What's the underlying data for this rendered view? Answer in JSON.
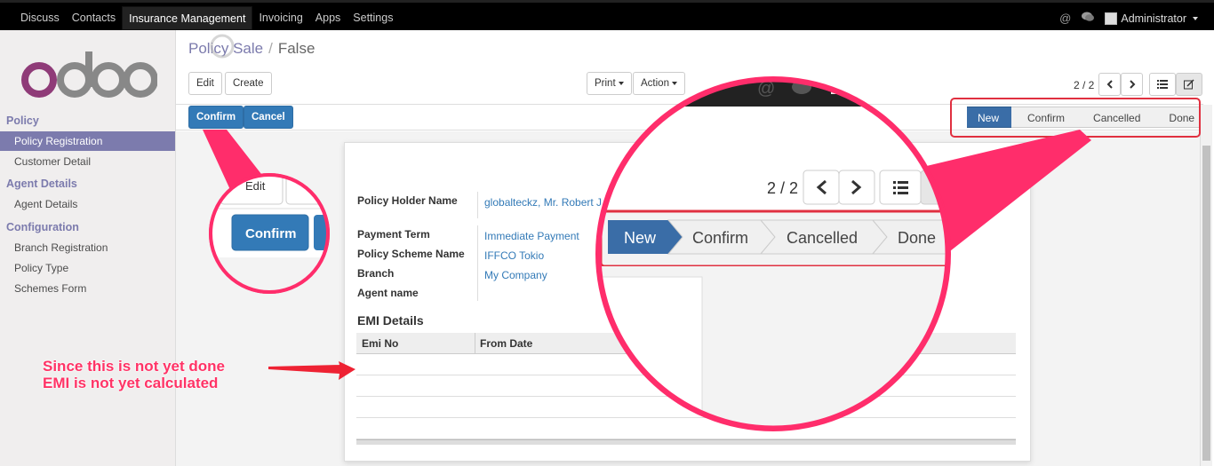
{
  "topbar": {
    "menu": [
      "Discuss",
      "Contacts",
      "Insurance Management",
      "Invoicing",
      "Apps",
      "Settings"
    ],
    "active_menu": "Insurance Management",
    "user": "Administrator",
    "icons": [
      "at-icon",
      "chat-icon",
      "avatar"
    ]
  },
  "sidebar": {
    "logo": "odoo",
    "groups": [
      {
        "title": "Policy",
        "items": [
          "Policy Registration",
          "Customer Detail"
        ]
      },
      {
        "title": "Agent Details",
        "items": [
          "Agent Details"
        ]
      },
      {
        "title": "Configuration",
        "items": [
          "Branch Registration",
          "Policy Type",
          "Schemes Form"
        ]
      }
    ],
    "active_item": "Policy Registration"
  },
  "breadcrumb": {
    "parent": "Policy Sale",
    "separator": "/",
    "current": "False"
  },
  "toolbar": {
    "edit": "Edit",
    "create": "Create",
    "print": "Print",
    "action": "Action",
    "pager": "2 / 2"
  },
  "workflow": {
    "confirm": "Confirm",
    "cancel": "Cancel",
    "stages": [
      "New",
      "Confirm",
      "Cancelled",
      "Done"
    ],
    "current_stage": "New"
  },
  "form": {
    "fields": [
      {
        "label": "Policy Holder Name",
        "value": "globalteckz, Mr. Robert J"
      },
      {
        "label": "Payment Term",
        "value": "Immediate Payment"
      },
      {
        "label": "Policy Scheme Name",
        "value": "IFFCO Tokio"
      },
      {
        "label": "Branch",
        "value": "My Company"
      },
      {
        "label": "Agent name",
        "value": ""
      }
    ],
    "emi": {
      "title": "EMI Details",
      "columns": [
        "Emi No",
        "From Date"
      ],
      "rows": []
    }
  },
  "zoom_left": {
    "edit": "Edit",
    "confirm": "Confirm"
  },
  "zoom_right": {
    "pager": "2 / 2",
    "stages": [
      "New",
      "Confirm",
      "Cancelled",
      "Done"
    ]
  },
  "annotation": {
    "line1": "Since this is not yet done",
    "line2": "EMI is not yet calculated",
    "color": "#ff3366"
  },
  "colors": {
    "brand": "#7c7bad",
    "primary": "#337ab7",
    "highlight": "#ff2d6b"
  }
}
